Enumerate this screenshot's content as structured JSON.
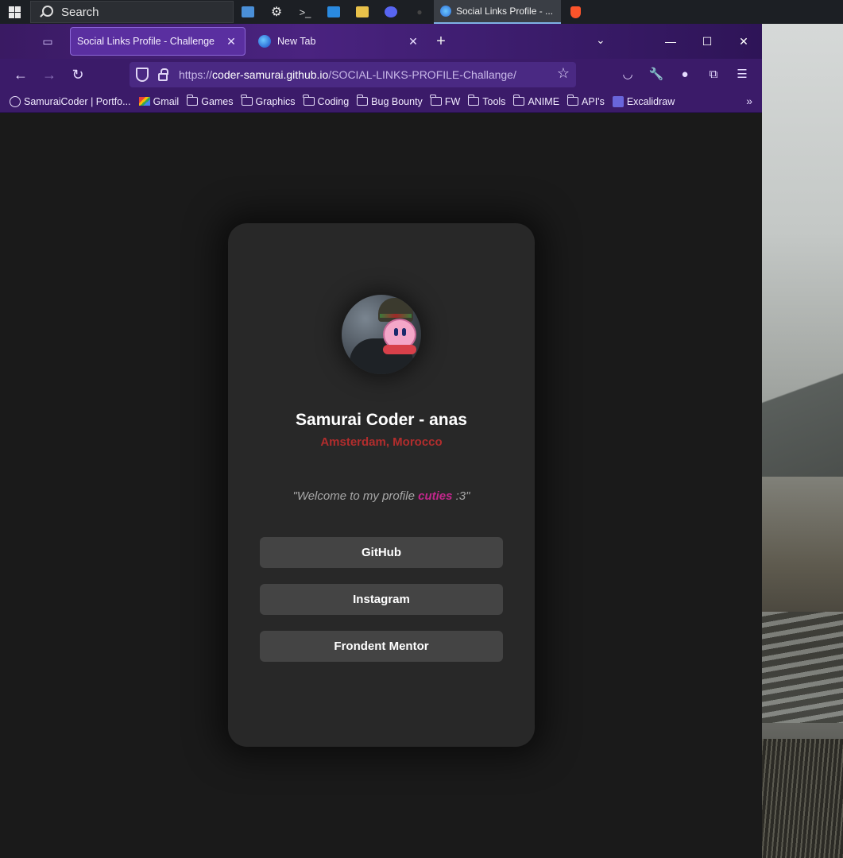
{
  "taskbar": {
    "search_label": "Search",
    "active_window_title": "Social Links Profile - ..."
  },
  "browser": {
    "tabs": [
      {
        "label": "Social Links Profile - Challenge",
        "active": true
      },
      {
        "label": "New Tab",
        "active": false
      }
    ],
    "url_scheme": "https://",
    "url_host": "coder-samurai.github.io",
    "url_path": "/SOCIAL-LINKS-PROFILE-Challange/",
    "bookmarks": [
      {
        "label": "SamuraiCoder | Portfo...",
        "icon": "globe-icon"
      },
      {
        "label": "Gmail",
        "icon": "gmail-icon"
      },
      {
        "label": "Games",
        "icon": "folder-icon"
      },
      {
        "label": "Graphics",
        "icon": "folder-icon"
      },
      {
        "label": "Coding",
        "icon": "folder-icon"
      },
      {
        "label": "Bug Bounty",
        "icon": "folder-icon"
      },
      {
        "label": "FW",
        "icon": "folder-icon"
      },
      {
        "label": "Tools",
        "icon": "folder-icon"
      },
      {
        "label": "ANIME",
        "icon": "folder-icon"
      },
      {
        "label": "API's",
        "icon": "folder-icon"
      },
      {
        "label": "Excalidraw",
        "icon": "excalidraw-icon"
      }
    ]
  },
  "profile": {
    "name": "Samurai Coder - anas",
    "location": "Amsterdam, Morocco",
    "quote_before": "\"Welcome to my profile ",
    "quote_highlight": "cuties",
    "quote_after": " :3\"",
    "links": [
      "GitHub",
      "Instagram",
      "Frondent Mentor"
    ]
  },
  "colors": {
    "page_bg": "#1a1a1a",
    "card_bg": "#282828",
    "button_bg": "#444444",
    "location": "#b12d2d",
    "highlight": "#c2278c",
    "browser_theme": "#3b1b69"
  }
}
